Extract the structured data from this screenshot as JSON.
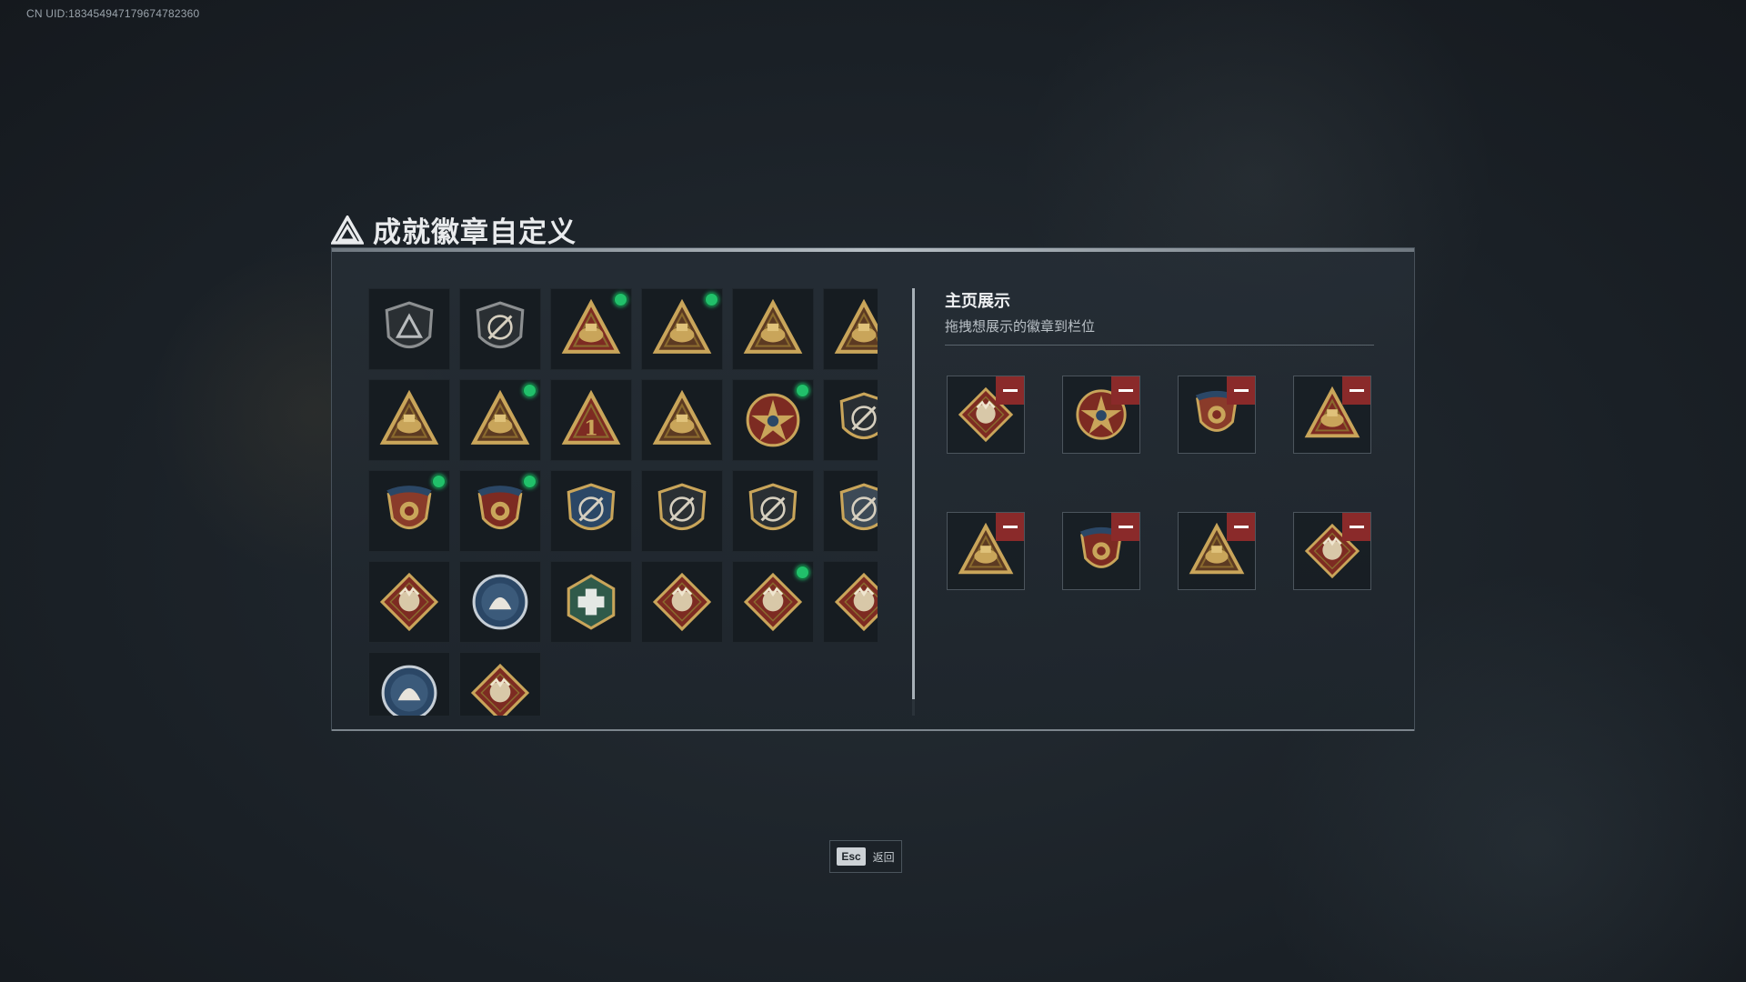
{
  "uid_text": "CN UID:1834549471796747823​60",
  "title": "成就徽章自定义",
  "colors": {
    "new_dot": "#21c06a",
    "remove_button": "#8a2a2a",
    "panel_border": "#48525b"
  },
  "badges": [
    {
      "icon": "grey-shield-triangle-badge-icon",
      "new": false
    },
    {
      "icon": "helicopter-shield-badge-icon",
      "new": false
    },
    {
      "icon": "red-triangle-emblem-badge-icon",
      "new": true
    },
    {
      "icon": "triangle-54-badge-icon",
      "new": true
    },
    {
      "icon": "triangle-56-badge-icon",
      "new": false
    },
    {
      "icon": "triangle-scroll-badge-icon",
      "new": false
    },
    {
      "icon": "triangle-tank-badge-icon",
      "new": false
    },
    {
      "icon": "triangle-boat-badge-icon",
      "new": true
    },
    {
      "icon": "triangle-number-one-badge-icon",
      "new": false
    },
    {
      "icon": "triangle-shield-badge-icon",
      "new": false
    },
    {
      "icon": "star-medal-badge-icon",
      "new": true
    },
    {
      "icon": "dark-shield-emblem-badge-icon",
      "new": false
    },
    {
      "icon": "crest-stars-badge-icon",
      "new": true
    },
    {
      "icon": "crest-stars-red-badge-icon",
      "new": true
    },
    {
      "icon": "blue-crossed-rifles-badge-icon",
      "new": false
    },
    {
      "icon": "rifle-shield-badge-icon",
      "new": false
    },
    {
      "icon": "sniper-shield-badge-icon",
      "new": false
    },
    {
      "icon": "gold-crossed-weapons-badge-icon",
      "new": false
    },
    {
      "icon": "wolf-diamond-badge-icon",
      "new": false
    },
    {
      "icon": "eagle-circle-badge-icon",
      "new": false
    },
    {
      "icon": "green-hex-medkit-badge-icon",
      "new": false
    },
    {
      "icon": "dragon-diamond-badge-icon",
      "new": false
    },
    {
      "icon": "dragon-diamond-red-badge-icon",
      "new": true
    },
    {
      "icon": "soldier-diamond-badge-icon",
      "new": true
    },
    {
      "icon": "wolf-circle-badge-icon",
      "new": false
    },
    {
      "icon": "wrench-diamond-badge-icon",
      "new": false
    }
  ],
  "showcase": {
    "title": "主页展示",
    "subtitle": "拖拽想展示的徽章到栏位",
    "slots": [
      {
        "icon": "dragon-diamond-badge-icon"
      },
      {
        "icon": "star-medal-badge-icon"
      },
      {
        "icon": "crest-stars-badge-icon"
      },
      {
        "icon": "red-triangle-emblem-badge-icon"
      },
      {
        "icon": "triangle-boat-badge-icon"
      },
      {
        "icon": "crest-stars-red-badge-icon"
      },
      {
        "icon": "triangle-54-badge-icon"
      },
      {
        "icon": "soldier-diamond-badge-icon"
      }
    ]
  },
  "footer": {
    "esc_key": "Esc",
    "esc_label": "返回"
  }
}
